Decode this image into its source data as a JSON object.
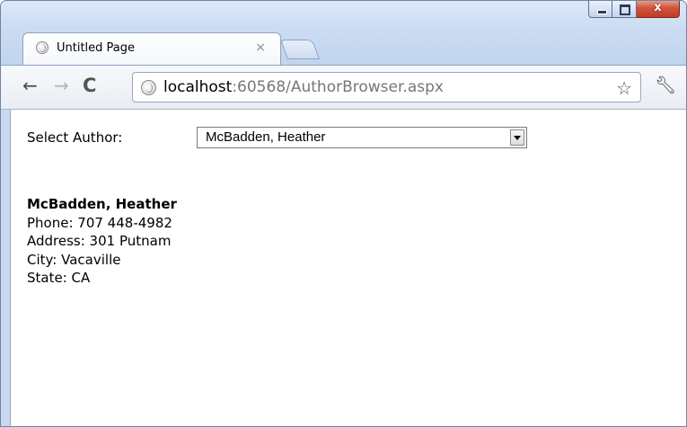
{
  "browser": {
    "tab_title": "Untitled Page",
    "tab_close": "×",
    "url_host": "localhost",
    "url_rest": ":60568/AuthorBrowser.aspx",
    "window_buttons": {
      "close": "x"
    }
  },
  "form": {
    "select_label": "Select Author:",
    "selected_author": "McBadden, Heather"
  },
  "author": {
    "name": "McBadden, Heather",
    "phone": "Phone: 707 448-4982",
    "address": "Address: 301 Putnam",
    "city": "City: Vacaville",
    "state": "State: CA"
  },
  "colors": {
    "frame": "#c9daf0",
    "close_button": "#c13a22"
  }
}
